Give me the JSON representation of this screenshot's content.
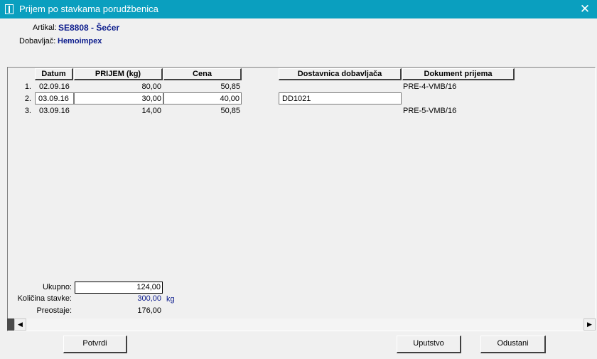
{
  "window": {
    "title": "Prijem po stavkama porudžbenica"
  },
  "header": {
    "artikal_label": "Artikal:",
    "artikal_value": "SE8808 - Šećer",
    "dobavljac_label": "Dobavljač:",
    "dobavljac_value": "Hemoimpex"
  },
  "table": {
    "columns": {
      "datum": "Datum",
      "prijem": "PRIJEM (kg)",
      "cena": "Cena",
      "dostavnica": "Dostavnica dobavljača",
      "dokument": "Dokument prijema"
    },
    "rows": [
      {
        "no": "1.",
        "datum": "02.09.16",
        "prijem": "80,00",
        "cena": "50,85",
        "dostavnica": "",
        "dokument": "PRE-4-VMB/16"
      },
      {
        "no": "2.",
        "datum": "03.09.16",
        "prijem": "30,00",
        "cena": "40,00",
        "dostavnica": "DD1021",
        "dokument": ""
      },
      {
        "no": "3.",
        "datum": "03.09.16",
        "prijem": "14,00",
        "cena": "50,85",
        "dostavnica": "",
        "dokument": "PRE-5-VMB/16"
      }
    ]
  },
  "totals": {
    "ukupno_label": "Ukupno:",
    "ukupno_value": "124,00",
    "kolicina_label": "Količina stavke:",
    "kolicina_value": "300,00",
    "kolicina_unit": "kg",
    "preostaje_label": "Preostaje:",
    "preostaje_value": "176,00"
  },
  "buttons": {
    "potvrdi": "Potvrdi",
    "uputstvo": "Uputstvo",
    "odustani": "Odustani"
  },
  "colors": {
    "titlebar": "#0a9fbf",
    "header_value": "#0b1b8c"
  }
}
